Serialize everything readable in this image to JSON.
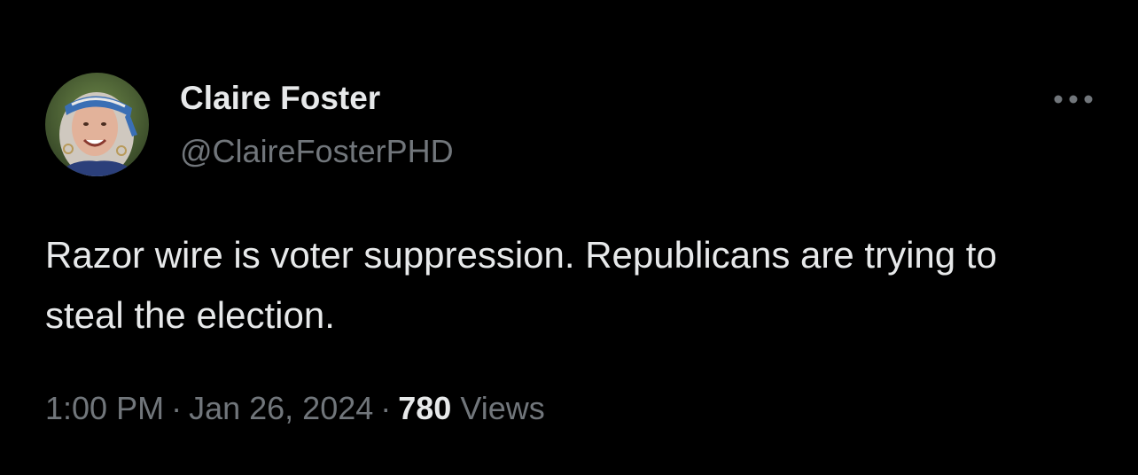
{
  "author": {
    "display_name": "Claire Foster",
    "handle": "@ClaireFosterPHD",
    "avatar_icon": "profile-photo"
  },
  "more_icon": "more-horizontal-icon",
  "tweet": {
    "text": "Razor wire is voter suppression. Republicans are trying to steal the election."
  },
  "meta": {
    "time": "1:00 PM",
    "separator": "·",
    "date": "Jan 26, 2024",
    "views_count": "780",
    "views_label": "Views"
  },
  "colors": {
    "background": "#000000",
    "primary_text": "#e7e9ea",
    "secondary_text": "#71767b"
  }
}
